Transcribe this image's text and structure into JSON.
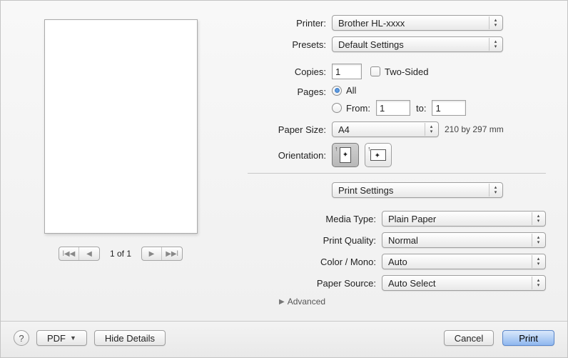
{
  "labels": {
    "printer": "Printer:",
    "presets": "Presets:",
    "copies": "Copies:",
    "twoSided": "Two-Sided",
    "pages": "Pages:",
    "all": "All",
    "from": "From:",
    "to": "to:",
    "paperSize": "Paper Size:",
    "orientation": "Orientation:",
    "mediaType": "Media Type:",
    "printQuality": "Print Quality:",
    "colorMono": "Color / Mono:",
    "paperSource": "Paper Source:",
    "advanced": "Advanced"
  },
  "values": {
    "printer": "Brother HL-xxxx",
    "presets": "Default Settings",
    "copies": "1",
    "pageFrom": "1",
    "pageTo": "1",
    "paperSize": "A4",
    "paperDim": "210 by 297 mm",
    "sectionSelect": "Print Settings",
    "mediaType": "Plain Paper",
    "printQuality": "Normal",
    "colorMono": "Auto",
    "paperSource": "Auto Select",
    "pageCounter": "1 of 1"
  },
  "footer": {
    "help": "?",
    "pdf": "PDF",
    "hideDetails": "Hide Details",
    "cancel": "Cancel",
    "print": "Print"
  }
}
